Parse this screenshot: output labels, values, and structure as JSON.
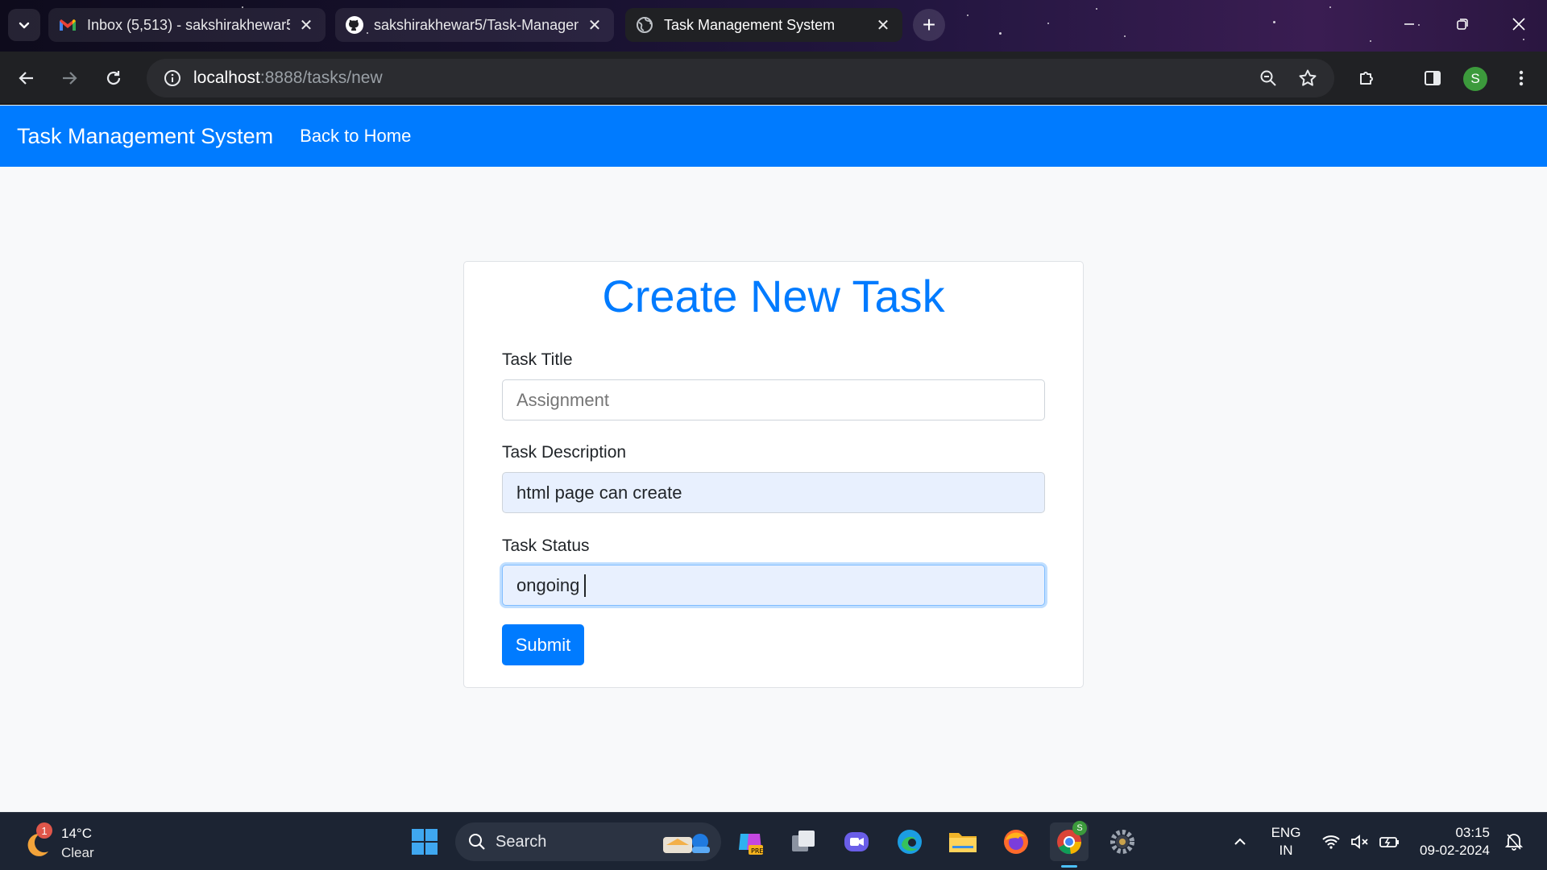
{
  "browser": {
    "tabs": [
      {
        "title": "Inbox (5,513) - sakshirakhewar5",
        "icon": "gmail-icon"
      },
      {
        "title": "sakshirakhewar5/Task-Managem",
        "icon": "github-icon"
      },
      {
        "title": "Task Management System",
        "icon": "globe-icon",
        "active": true
      }
    ],
    "url_host": "localhost",
    "url_path": ":8888/tasks/new",
    "profile_initial": "S"
  },
  "app": {
    "brand": "Task Management System",
    "nav_link": "Back to Home"
  },
  "form": {
    "heading": "Create New Task",
    "title_label": "Task Title",
    "title_placeholder": "Assignment",
    "description_label": "Task Description",
    "description_value": "html page can create",
    "status_label": "Task Status",
    "status_value": "ongoing",
    "submit_label": "Submit"
  },
  "taskbar": {
    "weather_temp": "14°C",
    "weather_condition": "Clear",
    "weather_badge": "1",
    "search_label": "Search",
    "lang_line1": "ENG",
    "lang_line2": "IN",
    "time": "03:15",
    "date": "09-02-2024",
    "chrome_badge": "S"
  },
  "colors": {
    "primary": "#007bff",
    "page_background": "#f8f9fa",
    "autofill_background": "#e8f0fe"
  }
}
